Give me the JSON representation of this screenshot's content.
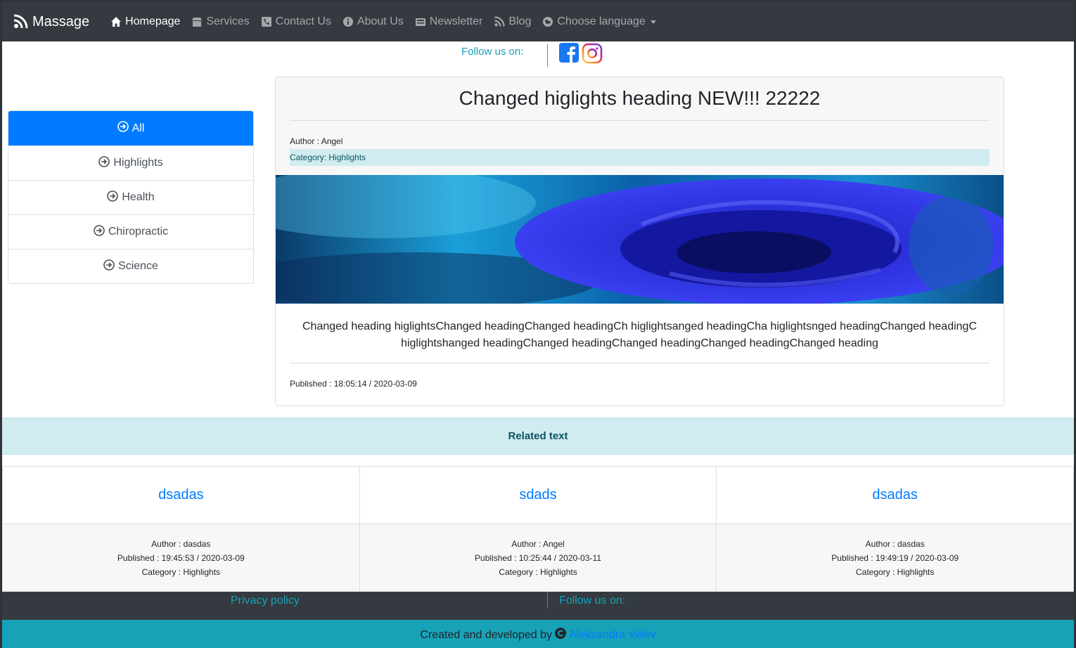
{
  "brand": {
    "name": "Massage",
    "icon": "blog-icon"
  },
  "nav": {
    "items": [
      {
        "label": "Homepage",
        "icon": "home-icon",
        "active": true
      },
      {
        "label": "Services",
        "icon": "store-icon",
        "active": false
      },
      {
        "label": "Contact Us",
        "icon": "contact-icon",
        "active": false
      },
      {
        "label": "About Us",
        "icon": "info-icon",
        "active": false
      },
      {
        "label": "Newsletter",
        "icon": "newsletter-icon",
        "active": false
      },
      {
        "label": "Blog",
        "icon": "blog-icon",
        "active": false
      },
      {
        "label": "Choose language",
        "icon": "globe-icon",
        "active": false
      }
    ]
  },
  "follow_top": {
    "label": "Follow us on:"
  },
  "sidebar": {
    "items": [
      {
        "label": "All",
        "active": true
      },
      {
        "label": "Highlights",
        "active": false
      },
      {
        "label": "Health",
        "active": false
      },
      {
        "label": "Chiropractic",
        "active": false
      },
      {
        "label": "Science",
        "active": false
      }
    ]
  },
  "article": {
    "title": "Changed higlights heading NEW!!! 22222",
    "author": "Author : Angel",
    "category": "Category: Highlights",
    "body": "Changed heading higlightsChanged headingChanged headingCh higlightsanged headingCha higlightsnged headingChanged headingC higlightshanged headingChanged headingChanged headingChanged headingChanged heading",
    "published": "Published : 18:05:14 / 2020-03-09"
  },
  "related": {
    "heading": "Related text",
    "items": [
      {
        "title": "dsadas",
        "author": "Author : dasdas",
        "published": "Published : 19:45:53 / 2020-03-09",
        "category": "Category : Highlights"
      },
      {
        "title": "sdads",
        "author": "Author : Angel",
        "published": "Published : 10:25:44 / 2020-03-11",
        "category": "Category : Highlights"
      },
      {
        "title": "dsadas",
        "author": "Author : dasdas",
        "published": "Published : 19:49:19 / 2020-03-09",
        "category": "Category : Highlights"
      }
    ]
  },
  "footer": {
    "privacy": "Privacy policy",
    "follow": "Follow us on:",
    "credit_prefix": "Created and developed by",
    "credit_author": "Aleksandra Velev"
  },
  "colors": {
    "navbar": "#343a40",
    "primary": "#007bff",
    "info": "#17a2b8",
    "info_light": "#d1ecf1"
  }
}
